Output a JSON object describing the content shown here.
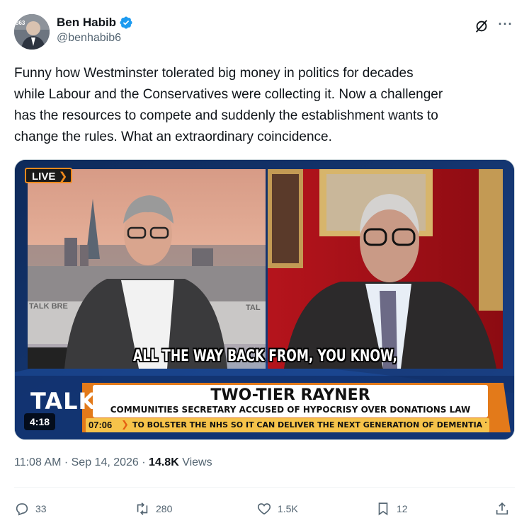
{
  "author": {
    "display_name": "Ben Habib",
    "handle": "@benhabib6",
    "avatar_tag": "863"
  },
  "tweet": {
    "text": "Funny how Westminster tolerated big money in politics for decades\nwhile Labour and the Conservatives were collecting it. Now a challenger\nhas the resources to compete and suddenly the establishment wants to\nchange the rules. What an extraordinary coincidence."
  },
  "video": {
    "live_label": "LIVE",
    "live_arrow": "❯",
    "studio_wall_text": "TALK BRE",
    "studio_wall_text2": "TAL",
    "subtitle": "ALL THE WAY BACK FROM, YOU KNOW,",
    "channel_logo": "TALK",
    "headline": "TWO-TIER RAYNER",
    "subheadline": "COMMUNITIES SECRETARY ACCUSED OF HYPOCRISY OVER DONATIONS LAW",
    "ticker_time": "07:06",
    "ticker_arrow": "❯",
    "ticker_text": "TO BOLSTER THE NHS SO IT CAN DELIVER THE NEXT GENERATION OF DEMENTIA TREATM",
    "duration": "4:18"
  },
  "meta": {
    "timestamp": "11:08 AM · Sep 14, 2026 · ",
    "views_count": "14.8K",
    "views_label": " Views"
  },
  "actions": {
    "replies": "33",
    "reposts": "280",
    "likes": "1.5K",
    "bookmarks": "12"
  },
  "colors": {
    "verified": "#1d9bf0",
    "icon_gray": "#536471",
    "accent_orange": "#f08a1d"
  },
  "icons": [
    "verified-badge-icon",
    "grok-icon",
    "more-icon",
    "reply-icon",
    "repost-icon",
    "like-icon",
    "bookmark-icon",
    "share-icon"
  ]
}
